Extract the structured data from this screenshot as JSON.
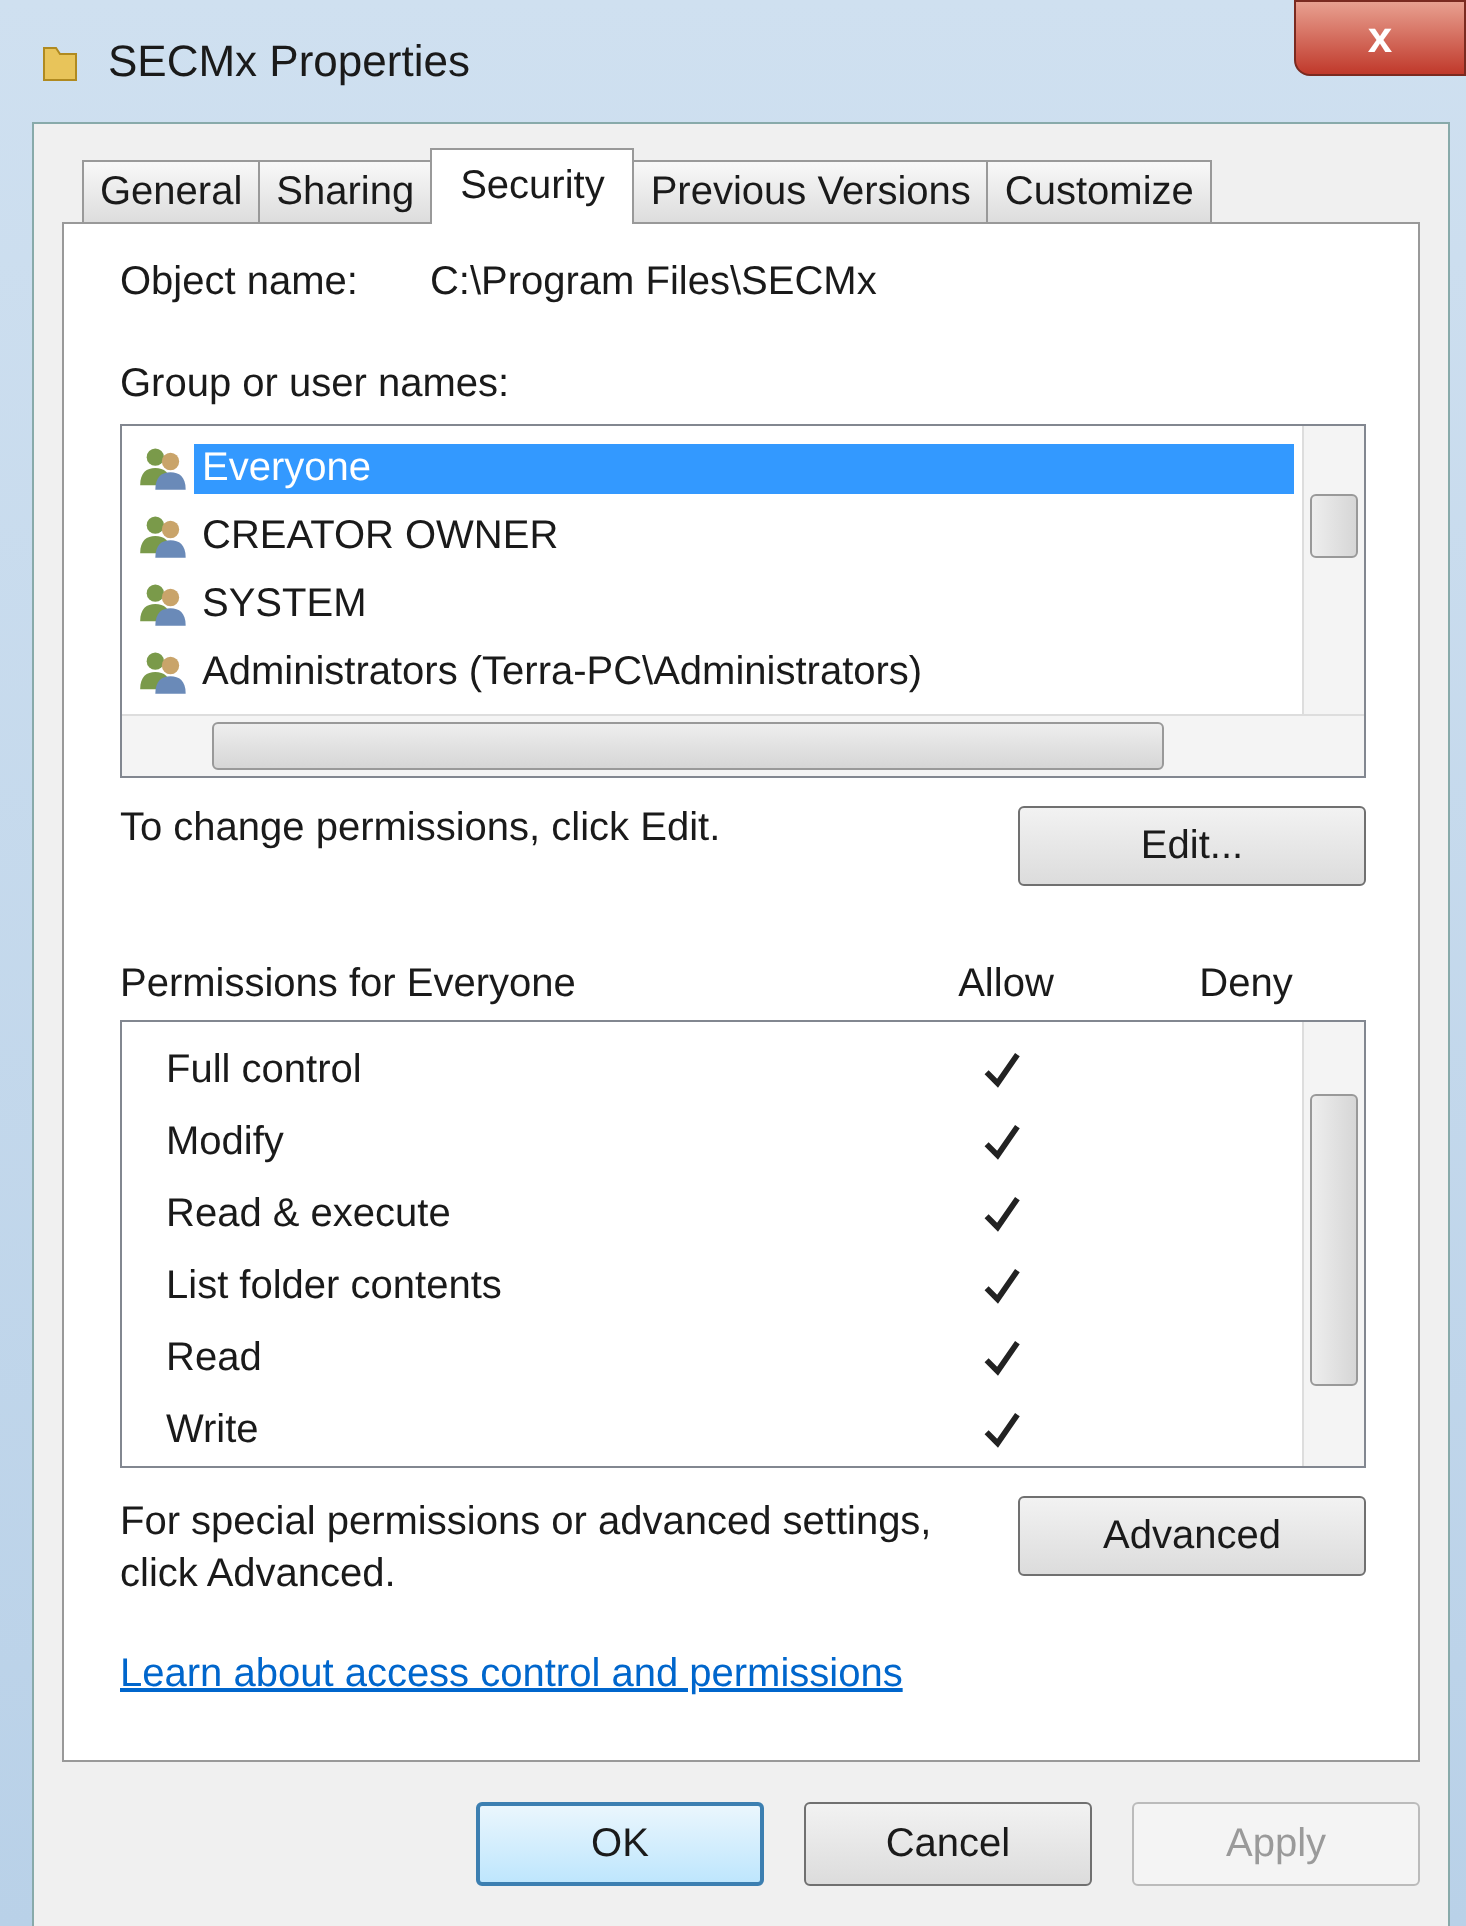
{
  "window": {
    "title": "SECMx Properties",
    "close_label": "x"
  },
  "tabs": [
    {
      "label": "General",
      "selected": false
    },
    {
      "label": "Sharing",
      "selected": false
    },
    {
      "label": "Security",
      "selected": true
    },
    {
      "label": "Previous Versions",
      "selected": false
    },
    {
      "label": "Customize",
      "selected": false
    }
  ],
  "object_name": {
    "label": "Object name:",
    "value": "C:\\Program Files\\SECMx"
  },
  "groups": {
    "label": "Group or user names:",
    "items": [
      {
        "name": "Everyone",
        "selected": true
      },
      {
        "name": "CREATOR OWNER",
        "selected": false
      },
      {
        "name": "SYSTEM",
        "selected": false
      },
      {
        "name": "Administrators (Terra-PC\\Administrators)",
        "selected": false
      }
    ]
  },
  "change_hint": "To change permissions, click Edit.",
  "edit_button": "Edit...",
  "permissions": {
    "label": "Permissions for Everyone",
    "allow_header": "Allow",
    "deny_header": "Deny",
    "rows": [
      {
        "name": "Full control",
        "allow": true,
        "deny": false
      },
      {
        "name": "Modify",
        "allow": true,
        "deny": false
      },
      {
        "name": "Read & execute",
        "allow": true,
        "deny": false
      },
      {
        "name": "List folder contents",
        "allow": true,
        "deny": false
      },
      {
        "name": "Read",
        "allow": true,
        "deny": false
      },
      {
        "name": "Write",
        "allow": true,
        "deny": false
      }
    ]
  },
  "special_hint": "For special permissions or advanced settings, click Advanced.",
  "advanced_button": "Advanced",
  "learn_link": "Learn about access control and permissions",
  "buttons": [
    {
      "label": "OK",
      "default": true,
      "disabled": false
    },
    {
      "label": "Cancel",
      "default": false,
      "disabled": false
    },
    {
      "label": "Apply",
      "default": false,
      "disabled": true
    }
  ]
}
